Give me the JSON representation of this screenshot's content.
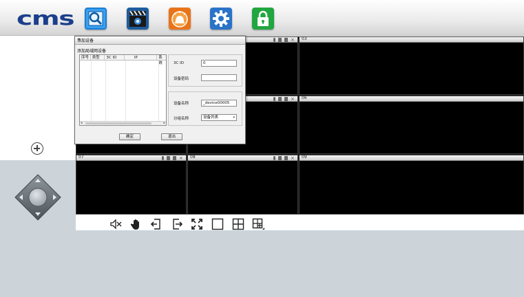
{
  "app": {
    "logo": "cms"
  },
  "toolbar_icons": [
    {
      "name": "search-device-icon",
      "color": "#1a7fd4"
    },
    {
      "name": "video-playback-icon",
      "color": "#2267a8"
    },
    {
      "name": "alarm-bell-icon",
      "color": "#e8741a"
    },
    {
      "name": "settings-gear-icon",
      "color": "#2a73c9"
    },
    {
      "name": "lock-icon",
      "color": "#21a640"
    }
  ],
  "grid": {
    "cells": [
      {
        "num": ""
      },
      {
        "num": ""
      },
      {
        "num": "03"
      },
      {
        "num": ""
      },
      {
        "num": ""
      },
      {
        "num": "06"
      },
      {
        "num": "07"
      },
      {
        "num": "08"
      },
      {
        "num": "09"
      }
    ]
  },
  "dialog": {
    "title": "添加设备",
    "close": "×",
    "subtitle": "添加局域网设备",
    "columns": [
      "序号",
      "类型",
      "3C ID",
      "IP",
      "系统"
    ],
    "form": {
      "id_label": "3C ID",
      "id_value": "0",
      "password_label": "设备密码",
      "password_value": "",
      "name_label": "设备名称",
      "name_value": "_device00005",
      "group_label": "分组名称",
      "group_value": "设备列表"
    },
    "ok_label": "确定",
    "cancel_label": "退出"
  },
  "bottom_toolbar": [
    "mute-icon",
    "pan-hand-icon",
    "previous-page-icon",
    "next-page-icon",
    "fullscreen-icon",
    "single-view-icon",
    "quad-view-icon",
    "multi-view-icon"
  ]
}
